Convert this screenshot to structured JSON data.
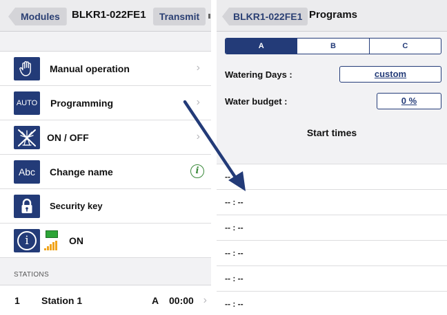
{
  "left_screen": {
    "nav": {
      "back_label": "Modules",
      "title": "BLKR1-022FE1",
      "transmit_label": "Transmit"
    },
    "menu": {
      "manual": {
        "icon": "hand-icon",
        "label": "Manual operation"
      },
      "programming": {
        "icon_text": "AUTO",
        "label": "Programming"
      },
      "onoff": {
        "icon": "sprinkler-off-icon",
        "label": "ON / OFF"
      },
      "rename": {
        "icon_text": "Abc",
        "label": "Change name",
        "info": "i"
      },
      "security": {
        "icon": "lock-icon",
        "label": "Security key"
      },
      "status": {
        "icon": "info-icon",
        "info_glyph": "i",
        "label": "ON"
      }
    },
    "stations_header": "STATIONS",
    "station": {
      "number": "1",
      "name": "Station 1",
      "program": "A",
      "time": "00:00"
    }
  },
  "right_screen": {
    "nav": {
      "back_label": "BLKR1-022FE1",
      "title": "Programs"
    },
    "program_tabs": [
      "A",
      "B",
      "C"
    ],
    "selected_tab": "A",
    "watering_days": {
      "label": "Watering Days :",
      "value": "custom"
    },
    "water_budget": {
      "label": "Water budget :",
      "value": "0 %"
    },
    "start_times_title": "Start times",
    "start_times": [
      "-- : --",
      "-- : --",
      "-- : --",
      "-- : --",
      "-- : --",
      "-- : --"
    ]
  },
  "colors": {
    "accent": "#233b78",
    "arrow": "#233b78",
    "battery": "#2da437",
    "signal": "#f0a41b",
    "info_green": "#3a8a3a"
  }
}
